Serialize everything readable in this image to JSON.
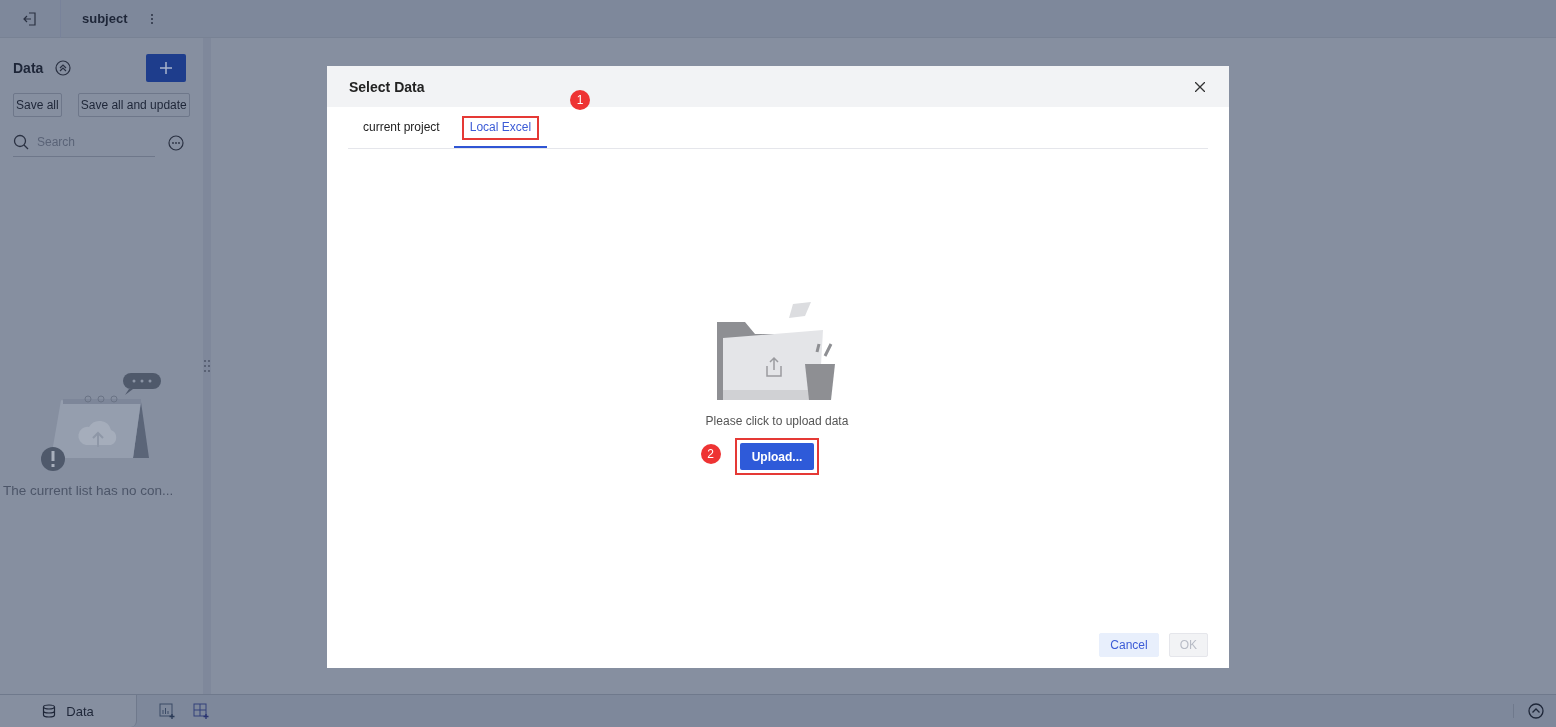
{
  "top_bar": {
    "title": "subject"
  },
  "sidebar": {
    "title": "Data",
    "buttons": [
      "Save all",
      "Save all and update"
    ],
    "search": {
      "placeholder": "Search"
    },
    "empty_message": "The current list has no con..."
  },
  "bottom_bar": {
    "tabs": [
      {
        "label": "Data",
        "selected": true
      }
    ]
  },
  "dialog": {
    "title": "Select Data",
    "tabs": [
      {
        "label": "current project",
        "selected": false
      },
      {
        "label": "Local Excel",
        "selected": true,
        "callout": "1"
      }
    ],
    "prompt": "Please click to upload data",
    "upload_button": {
      "label": "Upload...",
      "callout": "2"
    },
    "footer_buttons": [
      {
        "label": "Cancel",
        "disabled": false
      },
      {
        "label": "OK",
        "disabled": true
      }
    ]
  }
}
